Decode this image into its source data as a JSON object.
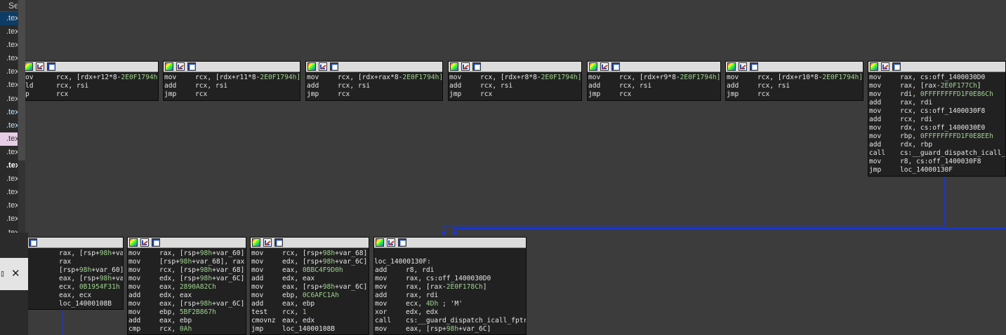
{
  "segments": {
    "header": "Se",
    "items": [
      ".tex",
      ".tex",
      ".tex",
      ".tex",
      ".tex",
      ".tex",
      ".tex",
      ".tex",
      ".tex",
      ".tex",
      ".tex",
      ".tex",
      ".tex",
      ".tex",
      ".tex",
      ".tex",
      ".tex"
    ]
  },
  "colors": {
    "background": "#3c3c3c",
    "block_bg": "#212121",
    "edge": "#1a36c8",
    "hex_literal": "#9fd38f"
  },
  "blocks": [
    {
      "lines": [
        [
          "ov",
          "rcx, [rdx+r12*8-",
          ""
        ],
        [
          "ld",
          "rcx, rsi",
          ""
        ],
        [
          "p",
          "rcx",
          ""
        ]
      ]
    },
    {
      "lines": [
        [
          "mov",
          "rcx, [rdx+r11*8-",
          ""
        ],
        [
          "add",
          "rcx, rsi",
          ""
        ],
        [
          "jmp",
          "rcx",
          ""
        ]
      ]
    },
    {
      "lines": [
        [
          "mov",
          "rcx, [rdx+rax*8-",
          ""
        ],
        [
          "add",
          "rcx, rsi",
          ""
        ],
        [
          "jmp",
          "rcx",
          ""
        ]
      ]
    },
    {
      "lines": [
        [
          "mov",
          "rcx, [rdx+r8*8-",
          ""
        ],
        [
          "add",
          "rcx, rsi",
          ""
        ],
        [
          "jmp",
          "rcx",
          ""
        ]
      ]
    },
    {
      "lines": [
        [
          "mov",
          "rcx, [rdx+r9*8-",
          ""
        ],
        [
          "add",
          "rcx, rsi",
          ""
        ],
        [
          "jmp",
          "rcx",
          ""
        ]
      ]
    },
    {
      "lines": [
        [
          "mov",
          "rcx, [rdx+r10*8-",
          ""
        ],
        [
          "add",
          "rcx, rsi",
          ""
        ],
        [
          "jmp",
          "rcx",
          ""
        ]
      ]
    },
    {
      "lines": [
        [
          "mov",
          "rax, cs:off_1400030D0",
          ""
        ],
        [
          "mov",
          "rax, [rax-",
          "2E0F177Ch]"
        ],
        [
          "mov",
          "rdi, ",
          "0FFFFFFFFD1F0E86Ch"
        ],
        [
          "add",
          "rax, rdi",
          ""
        ],
        [
          "mov",
          "rcx, cs:off_1400030F8",
          ""
        ],
        [
          "add",
          "rcx, rdi",
          ""
        ],
        [
          "mov",
          "rdx, cs:off_1400030E0",
          ""
        ],
        [
          "mov",
          "rbp, ",
          "0FFFFFFFFD1F0E8EEh"
        ],
        [
          "add",
          "rdx, rbp",
          ""
        ],
        [
          "call",
          "cs:__guard_dispatch_icall_f",
          ""
        ],
        [
          "mov",
          "r8, cs:off_1400030F8",
          ""
        ],
        [
          "jmp",
          "loc_14000130F",
          ""
        ]
      ]
    },
    {
      "lines": [
        [
          "",
          "rax, [rsp+",
          "98h+var_68]"
        ],
        [
          "",
          "rax",
          ""
        ],
        [
          "",
          "[rsp+",
          "98h+var_60], rax"
        ],
        [
          "",
          "eax, [rsp+",
          "98h+var_6C]"
        ],
        [
          "",
          "ecx, ",
          "0B1954F31h"
        ],
        [
          "",
          "eax, ecx",
          ""
        ],
        [
          "",
          "loc_14000108B",
          ""
        ]
      ]
    },
    {
      "lines": [
        [
          "mov",
          "rax, [rsp+",
          "98h+var_60]"
        ],
        [
          "mov",
          "[rsp+",
          "98h+var_68], rax"
        ],
        [
          "mov",
          "rcx, [rsp+",
          "98h+var_68]"
        ],
        [
          "mov",
          "edx, [rsp+",
          "98h+var_6C]"
        ],
        [
          "mov",
          "eax, ",
          "2890A82Ch"
        ],
        [
          "add",
          "edx, eax",
          ""
        ],
        [
          "mov",
          "eax, [rsp+",
          "98h+var_6C]"
        ],
        [
          "mov",
          "ebp, ",
          "5BF2B867h"
        ],
        [
          "add",
          "eax, ebp",
          ""
        ],
        [
          "cmp",
          "rcx, ",
          "0Ah"
        ]
      ]
    },
    {
      "lines": [
        [
          "mov",
          "rcx, [rsp+",
          "98h+var_68]"
        ],
        [
          "mov",
          "edx, [rsp+",
          "98h+var_6C]"
        ],
        [
          "mov",
          "eax, ",
          "0BBC4F9D0h"
        ],
        [
          "add",
          "edx, eax",
          ""
        ],
        [
          "mov",
          "eax, [rsp+",
          "98h+var_6C]"
        ],
        [
          "mov",
          "ebp, ",
          "0C6AFC1Ah"
        ],
        [
          "add",
          "eax, ebp",
          ""
        ],
        [
          "test",
          "rcx, ",
          "1"
        ],
        [
          "cmovnz",
          "eax, edx",
          ""
        ],
        [
          "jmp",
          "loc_14000108B",
          ""
        ]
      ]
    },
    {
      "lines": [
        [
          "",
          "",
          ""
        ],
        [
          "",
          "loc_14000130F:",
          ""
        ],
        [
          "add",
          "r8, rdi",
          ""
        ],
        [
          "mov",
          "rax, cs:off_1400030D0",
          ""
        ],
        [
          "mov",
          "rax, [rax-",
          "2E0F178Ch]"
        ],
        [
          "add",
          "rax, rdi",
          ""
        ],
        [
          "mov",
          "ecx, ",
          "4Dh ; 'M'"
        ],
        [
          "xor",
          "edx, edx",
          ""
        ],
        [
          "call",
          "cs:__guard_dispatch_icall_fptr",
          ""
        ],
        [
          "mov",
          "eax, [rsp+",
          "98h+var_6C]"
        ]
      ]
    }
  ],
  "block_suffix": "2E0F1794h]"
}
